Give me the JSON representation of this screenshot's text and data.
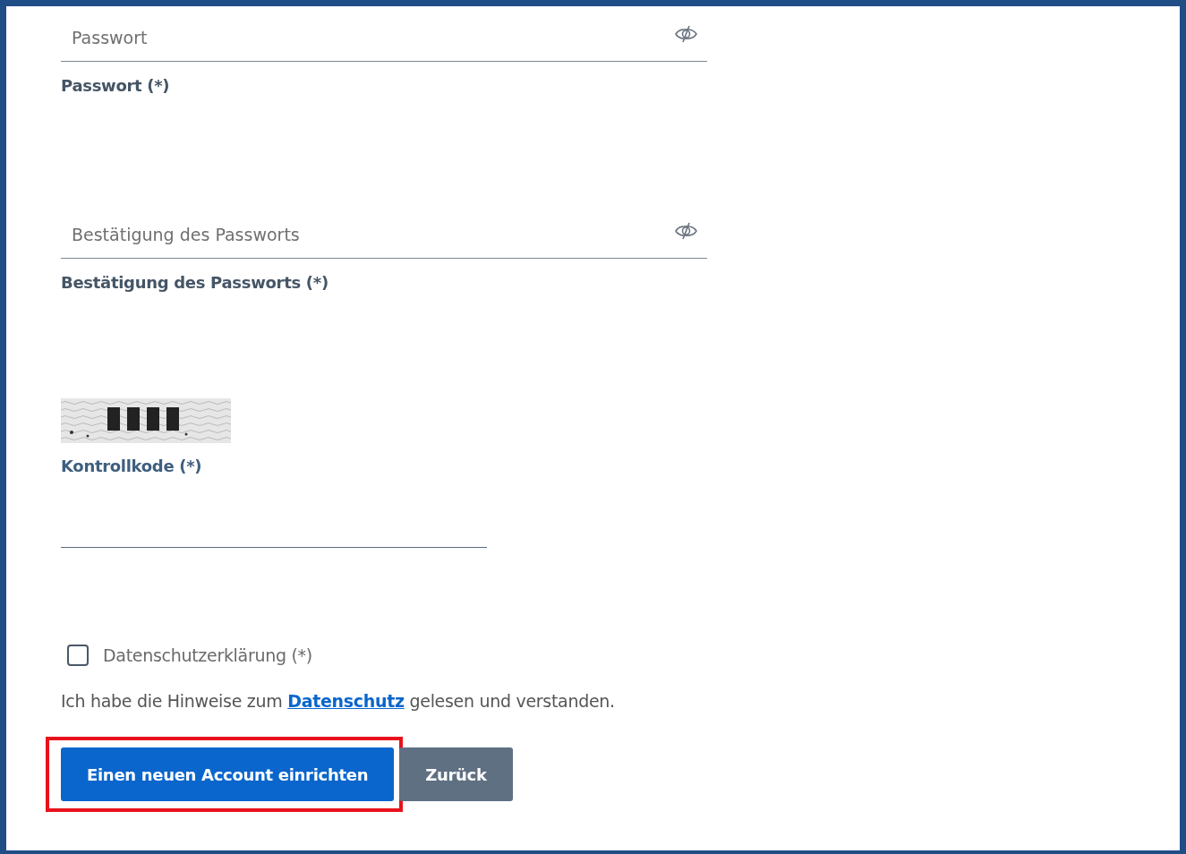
{
  "password_fields": [
    {
      "placeholder": "Passwort",
      "label": "Passwort (*)"
    },
    {
      "placeholder": "Bestätigung des Passworts",
      "label": "Bestätigung des Passworts (*)"
    }
  ],
  "captcha": {
    "kind": "picture",
    "label": "Kontrollkode (*)"
  },
  "consent": {
    "label": "Datenschutzerklärung (*)",
    "checked": false
  },
  "notice": {
    "before": "Ich habe die Hinweise zum ",
    "link": "Datenschutz",
    "after": " gelesen und verstanden."
  },
  "buttons": [
    {
      "label": "Einen neuen Account einrichten",
      "kind": "primary",
      "highlighted": true
    },
    {
      "label": "Zurück",
      "kind": "secondary",
      "highlighted": false
    }
  ]
}
